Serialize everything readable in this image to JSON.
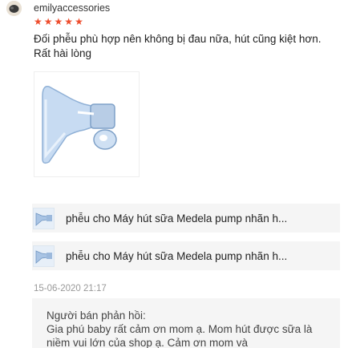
{
  "review": {
    "username": "emilyaccessories",
    "rating": 5,
    "text": "Đối phễu phù hợp nên không bị đau nữa, hút cũng kiệt hơn. Rất hài lòng",
    "timestamp": "15-06-2020 21:17"
  },
  "products": [
    {
      "name": "phễu cho Máy hút sữa Medela pump nhãn h..."
    },
    {
      "name": "phễu cho Máy hút sữa Medela pump nhãn h..."
    }
  ],
  "seller_response": {
    "label": "Người bán phản hồi:",
    "text": "Gia phú baby rất cảm ơn mom ạ. Mom hút được sữa là niềm vui lớn của shop ạ. Cảm ơn mom và"
  },
  "colors": {
    "star": "#ee4d2d",
    "box_bg": "#f5f5f5"
  }
}
